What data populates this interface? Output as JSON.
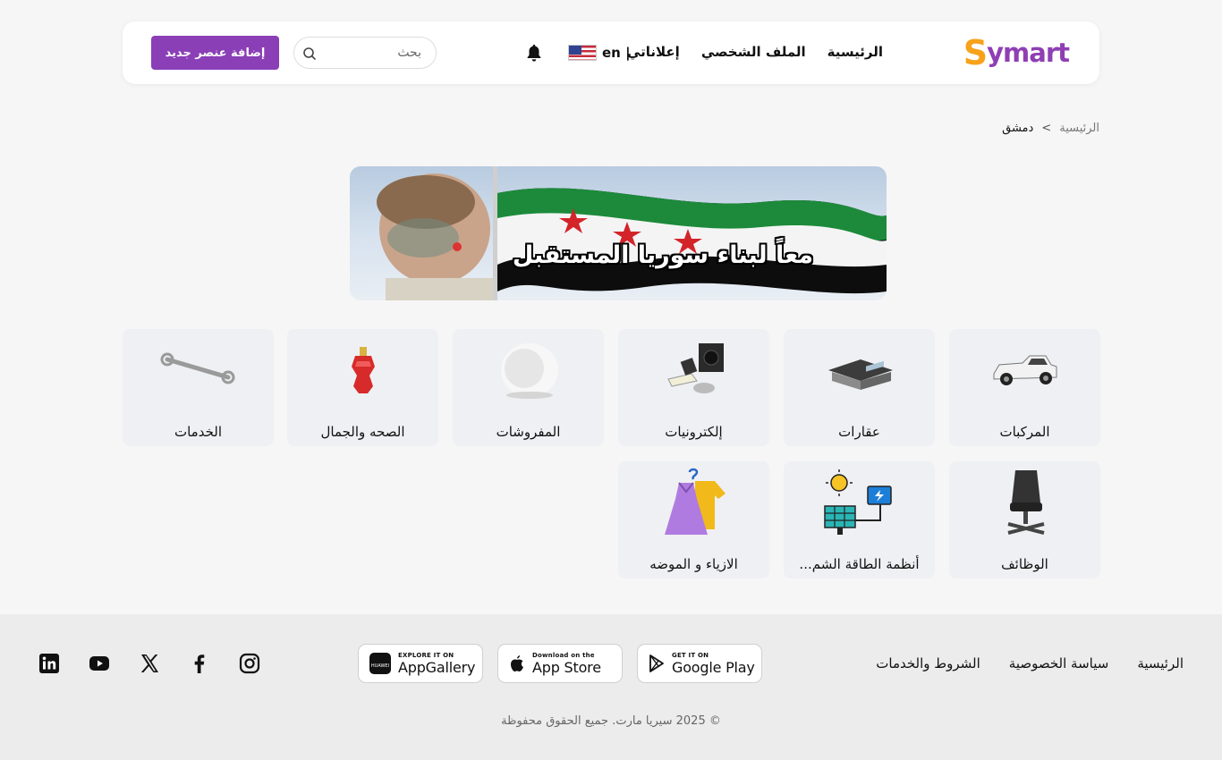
{
  "header": {
    "logo_text": "Symart",
    "nav": {
      "home": "الرئيسية",
      "profile": "الملف الشخصي",
      "my_ads": "إعلاناتي"
    },
    "language": "en |",
    "search_placeholder": "بحث",
    "add_button": "إضافة عنصر جديد"
  },
  "breadcrumb": {
    "home": "الرئيسية",
    "separator": ">",
    "current": "دمشق"
  },
  "banner": {
    "text": "معاً لبناء سوريا المستقبل"
  },
  "categories": [
    {
      "label": "المركبات",
      "icon": "pickup-truck-icon"
    },
    {
      "label": "عقارات",
      "icon": "house-icon"
    },
    {
      "label": "إلكترونيات",
      "icon": "electronics-icon"
    },
    {
      "label": "المفروشات",
      "icon": "armchair-icon"
    },
    {
      "label": "الصحه والجمال",
      "icon": "perfume-icon"
    },
    {
      "label": "الخدمات",
      "icon": "wrench-icon"
    },
    {
      "label": "الوظائف",
      "icon": "office-chair-icon"
    },
    {
      "label": "أنظمة الطاقة الشم...",
      "icon": "solar-energy-icon"
    },
    {
      "label": "الازياء و الموضه",
      "icon": "clothes-icon"
    }
  ],
  "footer": {
    "links": {
      "home": "الرئيسية",
      "privacy": "سياسة الخصوصية",
      "terms": "الشروط والخدمات"
    },
    "stores": {
      "google_play": {
        "small": "GET IT ON",
        "big": "Google Play"
      },
      "app_store": {
        "small": "Download on the",
        "big": "App Store"
      },
      "app_gallery": {
        "small": "EXPLORE IT ON",
        "big": "AppGallery"
      }
    },
    "social": [
      "instagram-icon",
      "facebook-icon",
      "x-icon",
      "youtube-icon",
      "linkedin-icon"
    ],
    "copyright": "© 2025 سيريا مارت. جميع الحقوق محفوظة"
  },
  "colors": {
    "brand_purple": "#8a3fb6",
    "brand_orange": "#f7a21b",
    "card_bg": "#eff0f3",
    "page_bg": "#f6f6f6",
    "footer_bg": "#ececec"
  }
}
